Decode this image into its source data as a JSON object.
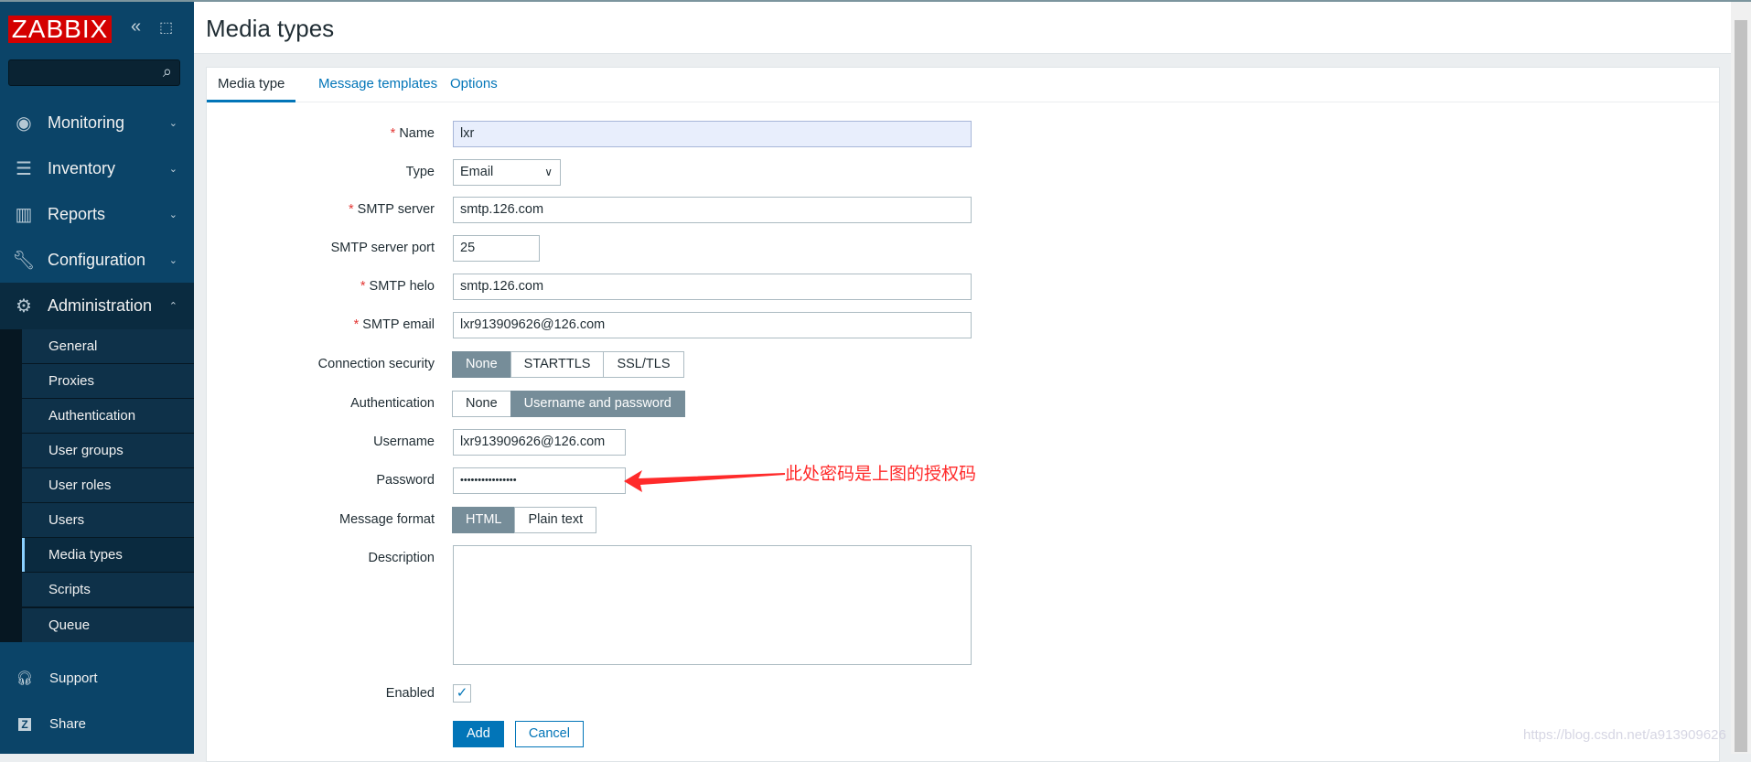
{
  "logo": "ZABBIX",
  "search": {
    "placeholder": ""
  },
  "menu": [
    {
      "label": "Monitoring",
      "icon": "eye-icon"
    },
    {
      "label": "Inventory",
      "icon": "list-icon"
    },
    {
      "label": "Reports",
      "icon": "bar-chart-icon"
    },
    {
      "label": "Configuration",
      "icon": "wrench-icon"
    },
    {
      "label": "Administration",
      "icon": "gear-icon"
    }
  ],
  "submenu": [
    "General",
    "Proxies",
    "Authentication",
    "User groups",
    "User roles",
    "Users",
    "Media types",
    "Scripts",
    "Queue"
  ],
  "footer": [
    {
      "label": "Support",
      "icon": "headset-icon"
    },
    {
      "label": "Share",
      "icon": "share-z-icon"
    }
  ],
  "page_title": "Media types",
  "tabs": [
    "Media type",
    "Message templates",
    "Options"
  ],
  "form": {
    "name": {
      "label": "Name",
      "value": "lxr"
    },
    "type": {
      "label": "Type",
      "value": "Email"
    },
    "smtp_server": {
      "label": "SMTP server",
      "value": "smtp.126.com"
    },
    "smtp_port": {
      "label": "SMTP server port",
      "value": "25"
    },
    "smtp_helo": {
      "label": "SMTP helo",
      "value": "smtp.126.com"
    },
    "smtp_email": {
      "label": "SMTP email",
      "value": "lxr913909626@126.com"
    },
    "conn_security": {
      "label": "Connection security",
      "options": [
        "None",
        "STARTTLS",
        "SSL/TLS"
      ],
      "selected": "None"
    },
    "auth": {
      "label": "Authentication",
      "options": [
        "None",
        "Username and password"
      ],
      "selected": "Username and password"
    },
    "username": {
      "label": "Username",
      "value": "lxr913909626@126.com"
    },
    "password": {
      "label": "Password",
      "value": "••••••••••••••••"
    },
    "msg_format": {
      "label": "Message format",
      "options": [
        "HTML",
        "Plain text"
      ],
      "selected": "HTML"
    },
    "description": {
      "label": "Description",
      "value": ""
    },
    "enabled": {
      "label": "Enabled",
      "checked": true
    },
    "add": "Add",
    "cancel": "Cancel"
  },
  "annotation": "此处密码是上图的授权码",
  "watermark": "https://blog.csdn.net/a913909626",
  "colors": {
    "sidebar": "#0b4468",
    "accent": "#0275b8",
    "annotation": "#ff2a2a"
  }
}
